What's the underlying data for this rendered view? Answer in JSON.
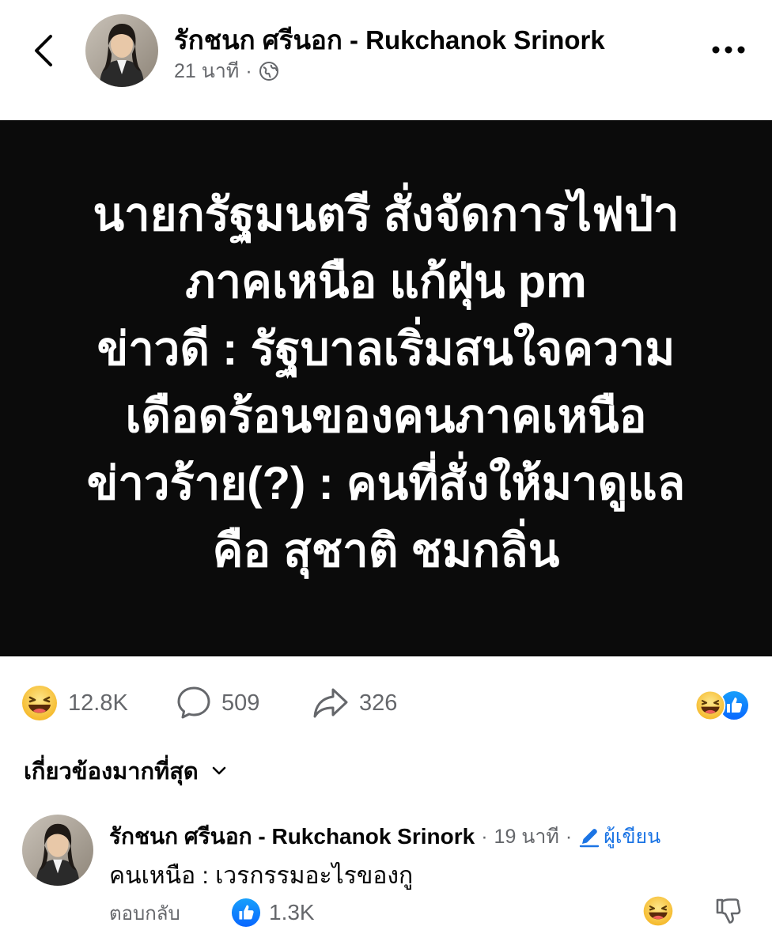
{
  "post": {
    "author": "รักชนก ศรีนอก - Rukchanok Srinork",
    "time": "21 นาที",
    "separator": "·",
    "privacy_icon": "globe-icon",
    "image_text": [
      "นายกรัฐมนตรี สั่งจัดการไฟป่า",
      "ภาคเหนือ แก้ฝุ่น pm",
      "ข่าวดี : รัฐบาลเริ่มสนใจความ",
      "เดือดร้อนของคนภาคเหนือ",
      "ข่าวร้าย(?) : คนที่สั่งให้มาดูแล",
      "คือ สุชาติ ชมกลิ่น"
    ]
  },
  "stats": {
    "reactions": "12.8K",
    "comments": "509",
    "shares": "326"
  },
  "sort": {
    "label": "เกี่ยวข้องมากที่สุด"
  },
  "comment": {
    "author": "รักชนก ศรีนอก - Rukchanok Srinork",
    "separator": "·",
    "time": "19 นาที",
    "author_badge": "ผู้เขียน",
    "text": "คนเหนือ : เวรกรรมอะไรของกู",
    "reply_label": "ตอบกลับ",
    "like_count": "1.3K"
  },
  "colors": {
    "accent": "#1b74e4",
    "secondary_text": "#65676b",
    "image_background": "#0b0b0b",
    "haha_yellow": "#f7c948"
  }
}
